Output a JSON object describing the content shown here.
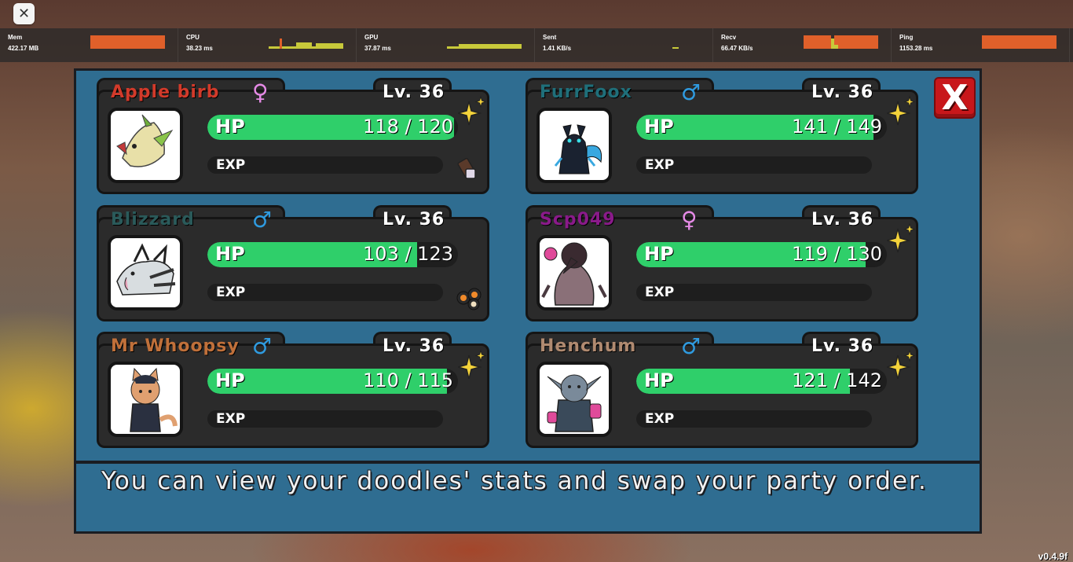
{
  "top": {
    "close_glyph": "✕"
  },
  "stats": [
    {
      "name": "Mem",
      "value": "422.17 MB"
    },
    {
      "name": "CPU",
      "value": "38.23 ms"
    },
    {
      "name": "GPU",
      "value": "37.87 ms"
    },
    {
      "name": "Sent",
      "value": "1.41 KB/s"
    },
    {
      "name": "Recv",
      "value": "66.47 KB/s"
    },
    {
      "name": "Ping",
      "value": "1153.28 ms"
    }
  ],
  "party": [
    {
      "name": "Apple birb",
      "gender": "♀",
      "gender_color": "#e58ae6",
      "level": "Lv. 36",
      "hp_label": "HP",
      "hp_text": "118 / 120",
      "hp_fraction": 0.983,
      "exp_label": "EXP",
      "sparkle": true,
      "item": "chocolate-icon"
    },
    {
      "name": "FurrFoox",
      "gender": "♂",
      "gender_color": "#2f9be0",
      "level": "Lv. 36",
      "hp_label": "HP",
      "hp_text": "141 / 149",
      "hp_fraction": 0.946,
      "exp_label": "EXP",
      "sparkle": true,
      "item": null
    },
    {
      "name": "Blizzard",
      "gender": "♂",
      "gender_color": "#2f9be0",
      "level": "Lv. 36",
      "hp_label": "HP",
      "hp_text": "103 / 123",
      "hp_fraction": 0.837,
      "exp_label": "EXP",
      "sparkle": false,
      "item": "sushi-icon"
    },
    {
      "name": "Scp049",
      "gender": "♀",
      "gender_color": "#e58ae6",
      "level": "Lv. 36",
      "hp_label": "HP",
      "hp_text": "119 / 130",
      "hp_fraction": 0.915,
      "exp_label": "EXP",
      "sparkle": true,
      "item": null
    },
    {
      "name": "Mr Whoopsy",
      "gender": "♂",
      "gender_color": "#2f9be0",
      "level": "Lv. 36",
      "hp_label": "HP",
      "hp_text": "110 / 115",
      "hp_fraction": 0.957,
      "exp_label": "EXP",
      "sparkle": true,
      "item": null
    },
    {
      "name": "Henchum",
      "gender": "♂",
      "gender_color": "#2f9be0",
      "level": "Lv. 36",
      "hp_label": "HP",
      "hp_text": "121 / 142",
      "hp_fraction": 0.852,
      "exp_label": "EXP",
      "sparkle": true,
      "item": null
    }
  ],
  "name_colors": [
    "#d23a2a",
    "#1f6f7a",
    "#2a3a3a",
    "#8a1a8a",
    "#7a3a1a",
    "#5a2a1a"
  ],
  "panel": {
    "close_label": "X",
    "footer_text": "You can view your doodles' stats and swap your party order."
  },
  "version": "v0.4.9f"
}
